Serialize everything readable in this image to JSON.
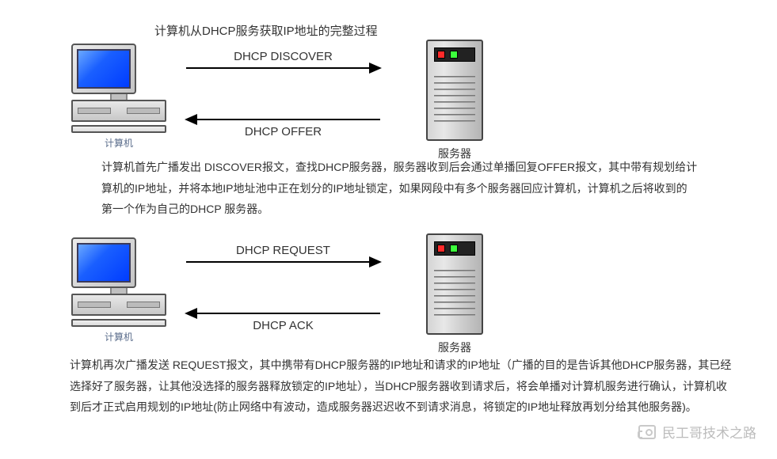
{
  "title": "计算机从DHCP服务获取IP地址的完整过程",
  "diagrams": [
    {
      "left_device_label": "计算机",
      "right_device_label": "服务器",
      "arrow_top_label": "DHCP DISCOVER",
      "arrow_top_dir": "right",
      "arrow_bottom_label": "DHCP OFFER",
      "arrow_bottom_dir": "left"
    },
    {
      "left_device_label": "计算机",
      "right_device_label": "服务器",
      "arrow_top_label": "DHCP REQUEST",
      "arrow_top_dir": "right",
      "arrow_bottom_label": "DHCP ACK",
      "arrow_bottom_dir": "left"
    }
  ],
  "paragraphs": [
    "计算机首先广播发出 DISCOVER报文，查找DHCP服务器，服务器收到后会通过单播回复OFFER报文，其中带有规划给计算机的IP地址，并将本地IP地址池中正在划分的IP地址锁定，如果网段中有多个服务器回应计算机，计算机之后将收到的第一个作为自己的DHCP 服务器。",
    "计算机再次广播发送 REQUEST报文，其中携带有DHCP服务器的IP地址和请求的IP地址（广播的目的是告诉其他DHCP服务器，其已经选择好了服务器，让其他没选择的服务器释放锁定的IP地址），当DHCP服务器收到请求后，将会单播对计算机服务进行确认，计算机收到后才正式启用规划的IP地址(防止网络中有波动，造成服务器迟迟收不到请求消息，将锁定的IP地址释放再划分给其他服务器)。"
  ],
  "watermark": "民工哥技术之路"
}
